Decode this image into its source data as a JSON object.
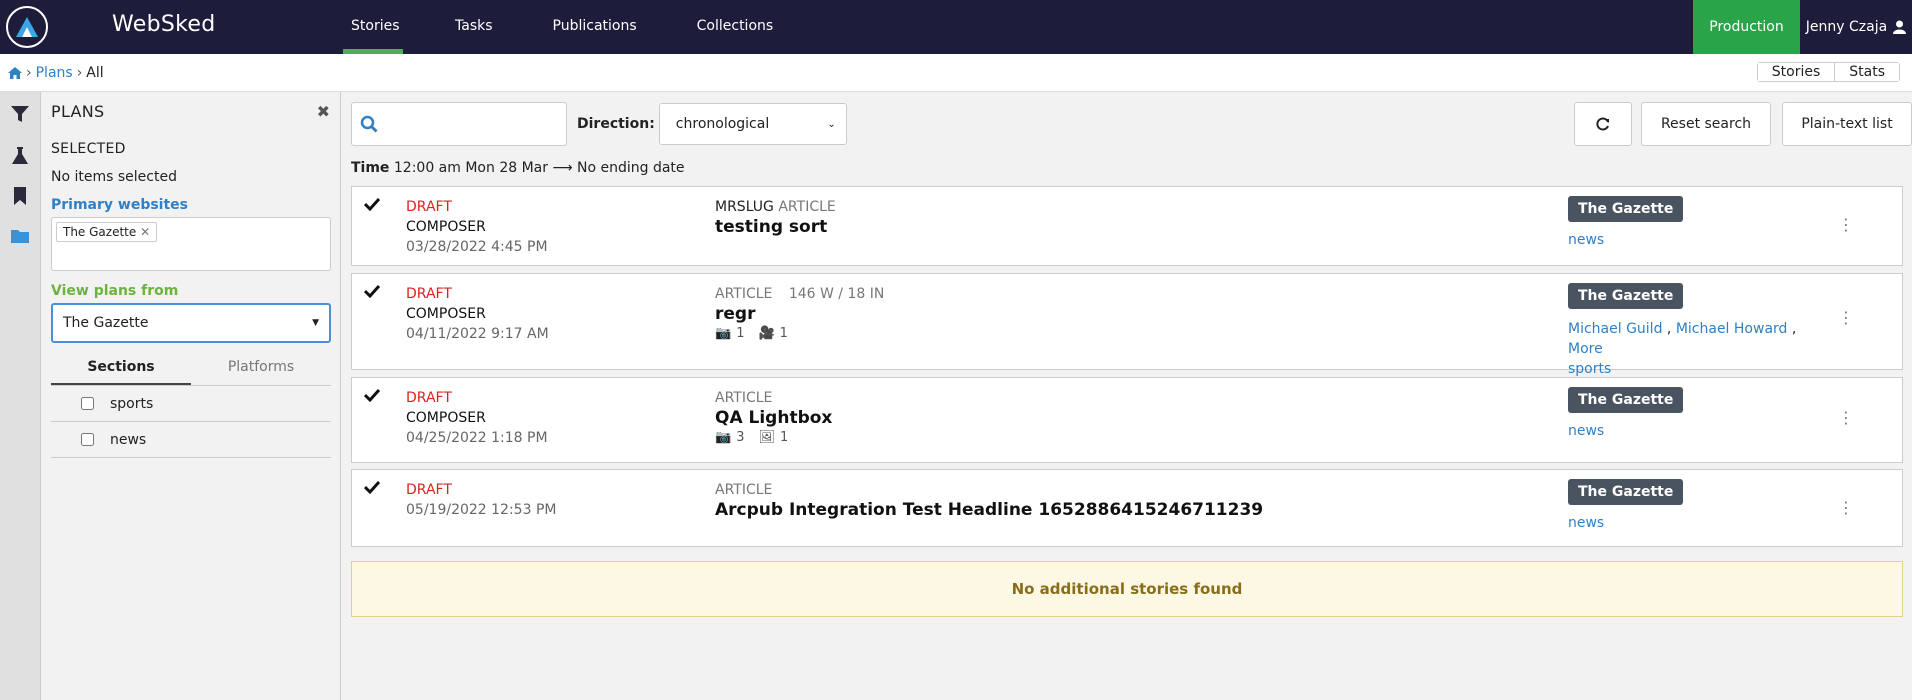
{
  "app": {
    "title": "WebSked"
  },
  "nav": {
    "tabs": [
      {
        "label": "Stories",
        "active": true
      },
      {
        "label": "Tasks",
        "active": false
      },
      {
        "label": "Publications",
        "active": false
      },
      {
        "label": "Collections",
        "active": false
      }
    ],
    "environment": "Production",
    "user": "Jenny Czaja"
  },
  "breadcrumb": {
    "plans": "Plans",
    "current": "All"
  },
  "view_toggle": {
    "stories": "Stories",
    "stats": "Stats"
  },
  "panel": {
    "title": "PLANS",
    "selected_label": "SELECTED",
    "selected_none": "No items selected",
    "primary_websites_label": "Primary websites",
    "primary_websites": [
      "The Gazette"
    ],
    "view_plans_label": "View plans from",
    "view_plans_value": "The Gazette",
    "tabs": [
      "Sections",
      "Platforms"
    ],
    "sections": [
      "sports",
      "news"
    ]
  },
  "toolbar": {
    "search_placeholder": "",
    "direction_label": "Direction:",
    "direction_value": "chronological",
    "reset_label": "Reset search",
    "plaintext_label": "Plain-text list"
  },
  "time_filter": {
    "label": "Time",
    "start": "12:00 am Mon 28 Mar",
    "end": "No ending date"
  },
  "stories": [
    {
      "status": "DRAFT",
      "source": "COMPOSER",
      "date": "03/28/2022 4:45 PM",
      "slug": "MRSLUG",
      "type": "ARTICLE",
      "stats": "",
      "headline": "testing sort",
      "photos": null,
      "videos": null,
      "images": null,
      "website": "The Gazette",
      "links": [
        "news"
      ]
    },
    {
      "status": "DRAFT",
      "source": "COMPOSER",
      "date": "04/11/2022 9:17 AM",
      "slug": "",
      "type": "ARTICLE",
      "stats": "146 W / 18 IN",
      "headline": "regr",
      "photos": "1",
      "videos": "1",
      "images": null,
      "website": "The Gazette",
      "links": [
        "Michael Guild",
        "Michael Howard",
        "More",
        "sports"
      ]
    },
    {
      "status": "DRAFT",
      "source": "COMPOSER",
      "date": "04/25/2022 1:18 PM",
      "slug": "",
      "type": "ARTICLE",
      "stats": "",
      "headline": "QA Lightbox",
      "photos": "3",
      "videos": null,
      "images": "1",
      "website": "The Gazette",
      "links": [
        "news"
      ]
    },
    {
      "status": "DRAFT",
      "source": "",
      "date": "05/19/2022 12:53 PM",
      "slug": "",
      "type": "ARTICLE",
      "stats": "",
      "headline": "Arcpub Integration Test Headline 1652886415246711239",
      "photos": null,
      "videos": null,
      "images": null,
      "website": "The Gazette",
      "links": [
        "news"
      ]
    }
  ],
  "empty_message": "No additional stories found"
}
